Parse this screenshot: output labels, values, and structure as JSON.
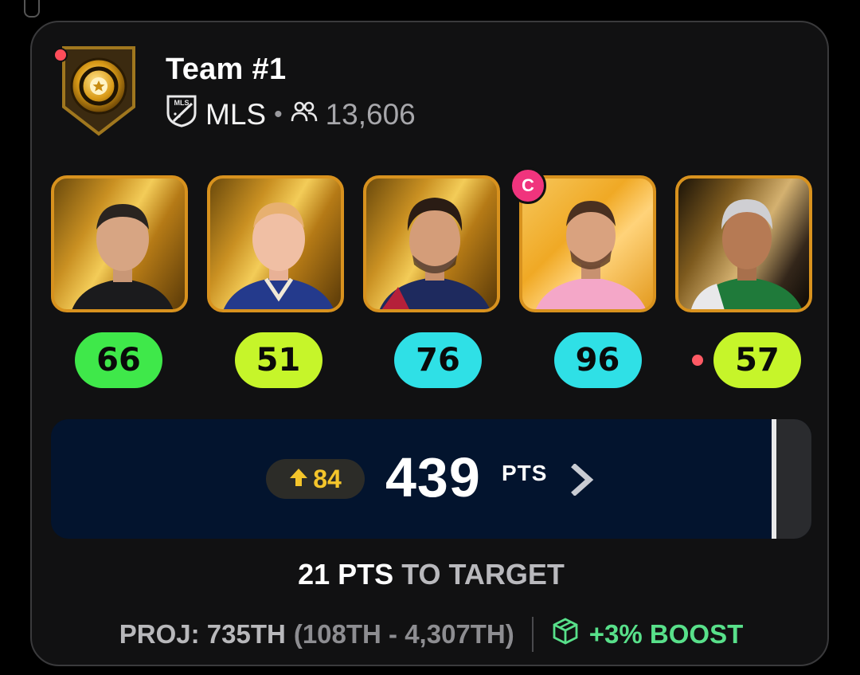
{
  "team": {
    "name": "Team #1",
    "league": "MLS",
    "separator": "•",
    "members": "13,606"
  },
  "players": [
    {
      "score": "66",
      "score_color": "#3fe84a",
      "captain": false,
      "alert": false
    },
    {
      "score": "51",
      "score_color": "#c6f52a",
      "captain": false,
      "alert": false
    },
    {
      "score": "76",
      "score_color": "#2fe0e6",
      "captain": false,
      "alert": false
    },
    {
      "score": "96",
      "score_color": "#2fe0e6",
      "captain": true,
      "alert": false
    },
    {
      "score": "57",
      "score_color": "#c6f52a",
      "captain": false,
      "alert": true
    }
  ],
  "captain_label": "C",
  "points": {
    "change": "84",
    "total": "439",
    "unit": "PTS"
  },
  "target": {
    "amount": "21 PTS",
    "text": "TO TARGET"
  },
  "footer": {
    "proj": "PROJ: 735TH",
    "range": "(108TH - 4,307TH)",
    "boost": "+3% BOOST"
  },
  "colors": {
    "accent_gold": "#f4c52b",
    "boost_green": "#58e08a",
    "panel_navy": "#03142e",
    "captain_pink": "#f0347d"
  }
}
